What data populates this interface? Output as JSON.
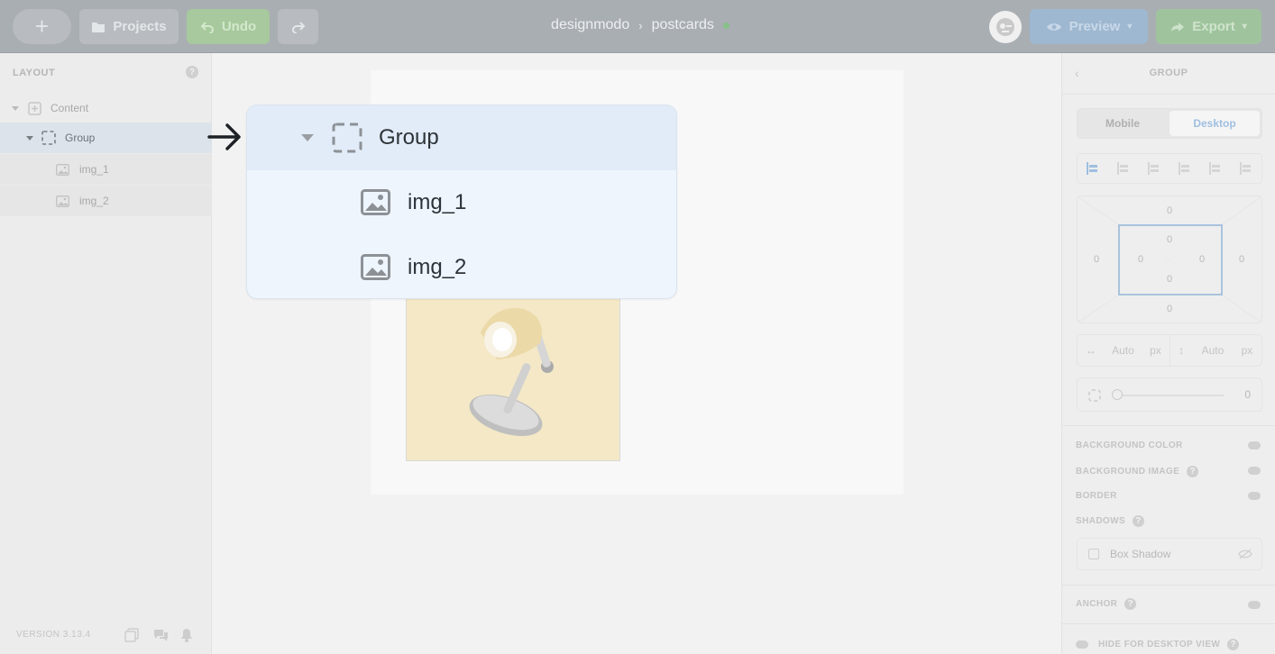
{
  "topbar": {
    "add_label": "+",
    "projects_label": "Projects",
    "undo_label": "Undo",
    "breadcrumb": [
      "designmodo",
      "postcards"
    ],
    "preview_label": "Preview",
    "export_label": "Export"
  },
  "sidebar": {
    "heading": "LAYOUT",
    "help": "?",
    "items": [
      {
        "label": "Content"
      },
      {
        "label": "Group"
      },
      {
        "label": "img_1"
      },
      {
        "label": "img_2"
      }
    ],
    "version": "VERSION 3.13.4"
  },
  "zoom": {
    "group_label": "Group",
    "img1_label": "img_1",
    "img2_label": "img_2"
  },
  "panel": {
    "title": "GROUP",
    "tabs": [
      "Mobile",
      "Desktop"
    ],
    "active_tab": "Desktop",
    "margin": {
      "top": "0",
      "right": "0",
      "bottom": "0",
      "left": "0"
    },
    "padding": {
      "top": "0",
      "right": "0",
      "bottom": "0",
      "left": "0"
    },
    "width_value": "Auto",
    "width_unit": "px",
    "height_value": "Auto",
    "height_unit": "px",
    "radius_value": "0",
    "sections": {
      "background_color": "BACKGROUND COLOR",
      "background_image": "BACKGROUND IMAGE",
      "border": "BORDER",
      "shadows": "SHADOWS",
      "anchor": "ANCHOR",
      "hide_desktop": "HIDE FOR DESKTOP VIEW"
    },
    "box_shadow_label": "Box Shadow"
  },
  "colors": {
    "selection_blue": "#e1ecf8",
    "active_blue": "#9fbfe0",
    "status_green": "#86c08a"
  }
}
